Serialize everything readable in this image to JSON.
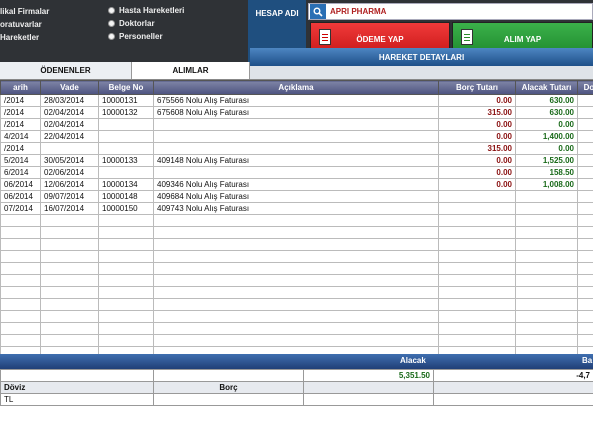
{
  "sidebar_left": {
    "items": [
      "likal Firmalar",
      "oratuvarlar",
      "Hareketler"
    ]
  },
  "radios": {
    "items": [
      "Hasta Hareketleri",
      "Doktorlar",
      "Personeller"
    ]
  },
  "hesap": {
    "label": "HESAP ADI",
    "value": "APRI PHARMA"
  },
  "buttons": {
    "odeme": "ÖDEME YAP",
    "alim": "ALIM YAP"
  },
  "tabs": {
    "odenenler": "ÖDENENLER",
    "alimlar": "ALIMLAR",
    "hareket_detaylari": "HAREKET DETAYLARI"
  },
  "grid": {
    "columns": [
      "arih",
      "Vade",
      "Belge No",
      "Açıklama",
      "Borç Tutarı",
      "Alacak Tutarı",
      "Do"
    ],
    "rows": [
      {
        "tarih": "/2014",
        "vade": "28/03/2014",
        "belge": "10000131",
        "aciklama": "675566 Nolu Alış Faturası",
        "borc": "0.00",
        "alacak": "630.00"
      },
      {
        "tarih": "/2014",
        "vade": "02/04/2014",
        "belge": "10000132",
        "aciklama": "675608 Nolu Alış Faturası",
        "borc": "315.00",
        "alacak": "630.00"
      },
      {
        "tarih": "/2014",
        "vade": "02/04/2014",
        "belge": "",
        "aciklama": "",
        "borc": "0.00",
        "alacak": "0.00"
      },
      {
        "tarih": "4/2014",
        "vade": "22/04/2014",
        "belge": "",
        "aciklama": "",
        "borc": "0.00",
        "alacak": "1,400.00"
      },
      {
        "tarih": "/2014",
        "vade": "",
        "belge": "",
        "aciklama": "",
        "borc": "315.00",
        "alacak": "0.00"
      },
      {
        "tarih": "5/2014",
        "vade": "30/05/2014",
        "belge": "10000133",
        "aciklama": "409148 Nolu Alış Faturası",
        "borc": "0.00",
        "alacak": "1,525.00"
      },
      {
        "tarih": "6/2014",
        "vade": "02/06/2014",
        "belge": "",
        "aciklama": "",
        "borc": "0.00",
        "alacak": "158.50"
      },
      {
        "tarih": "06/2014",
        "vade": "12/06/2014",
        "belge": "10000134",
        "aciklama": "409346 Nolu Alış Faturası",
        "borc": "0.00",
        "alacak": "1,008.00"
      },
      {
        "tarih": "06/2014",
        "vade": "09/07/2014",
        "belge": "10000148",
        "aciklama": "409684 Nolu Alış Faturası",
        "borc": "",
        "alacak": ""
      },
      {
        "tarih": "07/2014",
        "vade": "16/07/2014",
        "belge": "10000150",
        "aciklama": "409743 Nolu Alış Faturası",
        "borc": "",
        "alacak": ""
      }
    ]
  },
  "footer": {
    "alacak_label": "Alacak",
    "bakiye_label": "Ba",
    "doviz_label": "Döviz",
    "borc_label": "Borç",
    "currency": "TL",
    "alacak_value": "5,351.50",
    "bakiye_value": "-4,7"
  },
  "colors": {
    "accent_blue": "#1f4f7f",
    "odeme_red": "#e02828",
    "alim_green": "#2ea03e",
    "header_purple": "#5a6088"
  }
}
